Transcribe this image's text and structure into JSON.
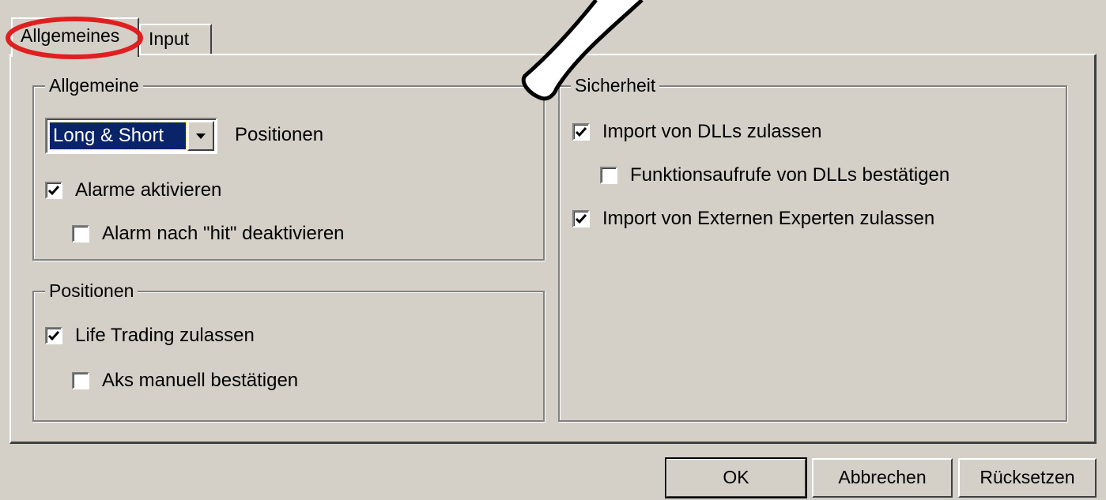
{
  "tabs": [
    {
      "label": "Allgemeines",
      "active": true
    },
    {
      "label": "Input",
      "active": false
    }
  ],
  "groups": {
    "allgemeine": {
      "title": "Allgemeine",
      "combo_value": "Long & Short",
      "combo_label": "Positionen",
      "alarms_enable": {
        "label": "Alarme aktivieren",
        "checked": true
      },
      "alarm_disable_after_hit": {
        "label": "Alarm nach \"hit\" deaktivieren",
        "checked": false
      }
    },
    "positionen": {
      "title": "Positionen",
      "life_trading": {
        "label": "Life Trading zulassen",
        "checked": true
      },
      "manual_confirm": {
        "label": "Aks manuell bestätigen",
        "checked": false
      }
    },
    "sicherheit": {
      "title": "Sicherheit",
      "import_dlls": {
        "label": "Import von DLLs zulassen",
        "checked": true
      },
      "confirm_dll_calls": {
        "label": "Funktionsaufrufe von DLLs bestätigen",
        "checked": false
      },
      "import_experts": {
        "label": "Import von Externen Experten zulassen",
        "checked": true
      }
    }
  },
  "buttons": {
    "ok": "OK",
    "cancel": "Abbrechen",
    "reset": "Rücksetzen"
  },
  "annotation": {
    "highlight_color": "#e02020",
    "pointer_color": "#000000"
  },
  "icons": {
    "checkmark": "checkmark-icon",
    "dropdown": "chevron-down-icon"
  }
}
